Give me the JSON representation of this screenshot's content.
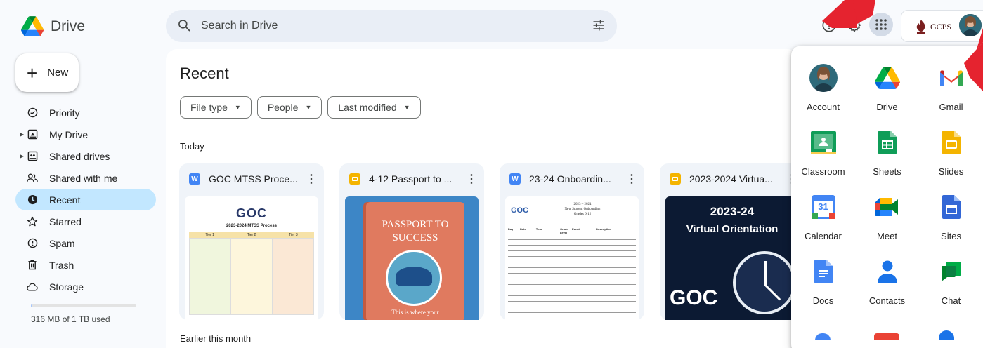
{
  "app": {
    "title": "Drive"
  },
  "search": {
    "placeholder": "Search in Drive"
  },
  "topbar": {
    "org_label": "GCPS"
  },
  "new_button": {
    "label": "New"
  },
  "sidebar": {
    "items": [
      {
        "label": "Priority",
        "icon": "priority-icon",
        "expandable": false,
        "active": false
      },
      {
        "label": "My Drive",
        "icon": "my-drive-icon",
        "expandable": true,
        "active": false
      },
      {
        "label": "Shared drives",
        "icon": "shared-drives-icon",
        "expandable": true,
        "active": false
      },
      {
        "label": "Shared with me",
        "icon": "shared-with-me-icon",
        "expandable": false,
        "active": false
      },
      {
        "label": "Recent",
        "icon": "recent-clock-icon",
        "expandable": false,
        "active": true
      },
      {
        "label": "Starred",
        "icon": "star-icon",
        "expandable": false,
        "active": false
      },
      {
        "label": "Spam",
        "icon": "spam-icon",
        "expandable": false,
        "active": false
      },
      {
        "label": "Trash",
        "icon": "trash-icon",
        "expandable": false,
        "active": false
      },
      {
        "label": "Storage",
        "icon": "cloud-icon",
        "expandable": false,
        "active": false
      }
    ],
    "storage_text": "316 MB of 1 TB used",
    "storage_used_fraction": 0.0003
  },
  "main": {
    "title": "Recent",
    "filters": [
      "File type",
      "People",
      "Last modified"
    ],
    "section_today": "Today",
    "section_earlier": "Earlier this month",
    "files": [
      {
        "type": "doc",
        "type_letter": "W",
        "name": "GOC MTSS Proce...",
        "thumb": {
          "logo": "GOC",
          "title": "2023-2024 MTSS Process",
          "cols": [
            "Tier 1",
            "Tier 2",
            "Tier 3"
          ]
        }
      },
      {
        "type": "slides",
        "name": "4-12 Passport to ...",
        "thumb": {
          "line1": "PASSPORT TO",
          "line2": "SUCCESS",
          "footer": "This is where your"
        }
      },
      {
        "type": "doc",
        "type_letter": "W",
        "name": "23-24 Onboardin...",
        "thumb": {
          "logo": "GOC",
          "title_lines": [
            "2023 – 2024",
            "New Student Onboarding",
            "Grades 6-12"
          ],
          "cols": [
            "Day",
            "Date",
            "Time",
            "Grade Level",
            "Event",
            "Description"
          ]
        }
      },
      {
        "type": "slides",
        "name": "2023-2024 Virtua...",
        "thumb": {
          "line1": "2023-24",
          "line2": "Virtual Orientation",
          "logo": "GOC"
        }
      }
    ]
  },
  "apps_panel": {
    "apps": [
      {
        "label": "Account",
        "icon": "account-avatar-icon"
      },
      {
        "label": "Drive",
        "icon": "drive-icon"
      },
      {
        "label": "Gmail",
        "icon": "gmail-icon"
      },
      {
        "label": "Classroom",
        "icon": "classroom-icon"
      },
      {
        "label": "Sheets",
        "icon": "sheets-icon"
      },
      {
        "label": "Slides",
        "icon": "slides-icon"
      },
      {
        "label": "Calendar",
        "icon": "calendar-icon",
        "badge": "31"
      },
      {
        "label": "Meet",
        "icon": "meet-icon"
      },
      {
        "label": "Sites",
        "icon": "sites-icon"
      },
      {
        "label": "Docs",
        "icon": "docs-icon"
      },
      {
        "label": "Contacts",
        "icon": "contacts-icon"
      },
      {
        "label": "Chat",
        "icon": "chat-icon"
      }
    ]
  },
  "colors": {
    "page_bg": "#f8fafd",
    "active_nav": "#c2e7ff",
    "annotation_arrow": "#e5232f",
    "frame_border": "#0b1640"
  }
}
